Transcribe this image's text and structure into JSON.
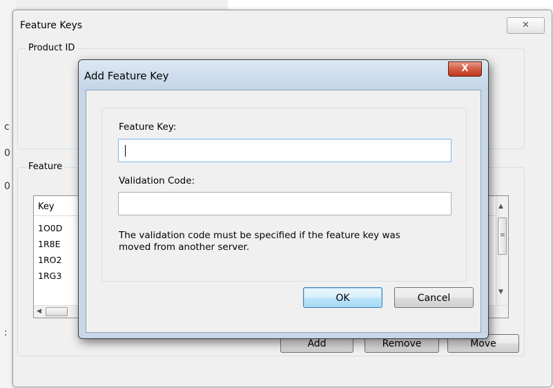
{
  "background": {
    "fragments": [
      "c",
      "0",
      "0",
      ":"
    ]
  },
  "feature_keys_window": {
    "title": "Feature Keys",
    "close_glyph": "✕",
    "product_group_label": "Product ID",
    "feature_group_label": "Feature",
    "list": {
      "column_header": "Key",
      "rows": [
        "1O0D",
        "1R8E",
        "1RO2",
        "1RG3"
      ]
    },
    "buttons": {
      "add": "Add",
      "remove": "Remove",
      "move": "Move"
    }
  },
  "dialog": {
    "title": "Add Feature Key",
    "close_glyph": "X",
    "feature_key_label": "Feature Key:",
    "feature_key_value": "",
    "validation_code_label": "Validation Code:",
    "validation_code_value": "",
    "help_text_line1": "The validation code must be specified if the feature key was",
    "help_text_line2": "moved from another server.",
    "ok_label": "OK",
    "cancel_label": "Cancel"
  }
}
